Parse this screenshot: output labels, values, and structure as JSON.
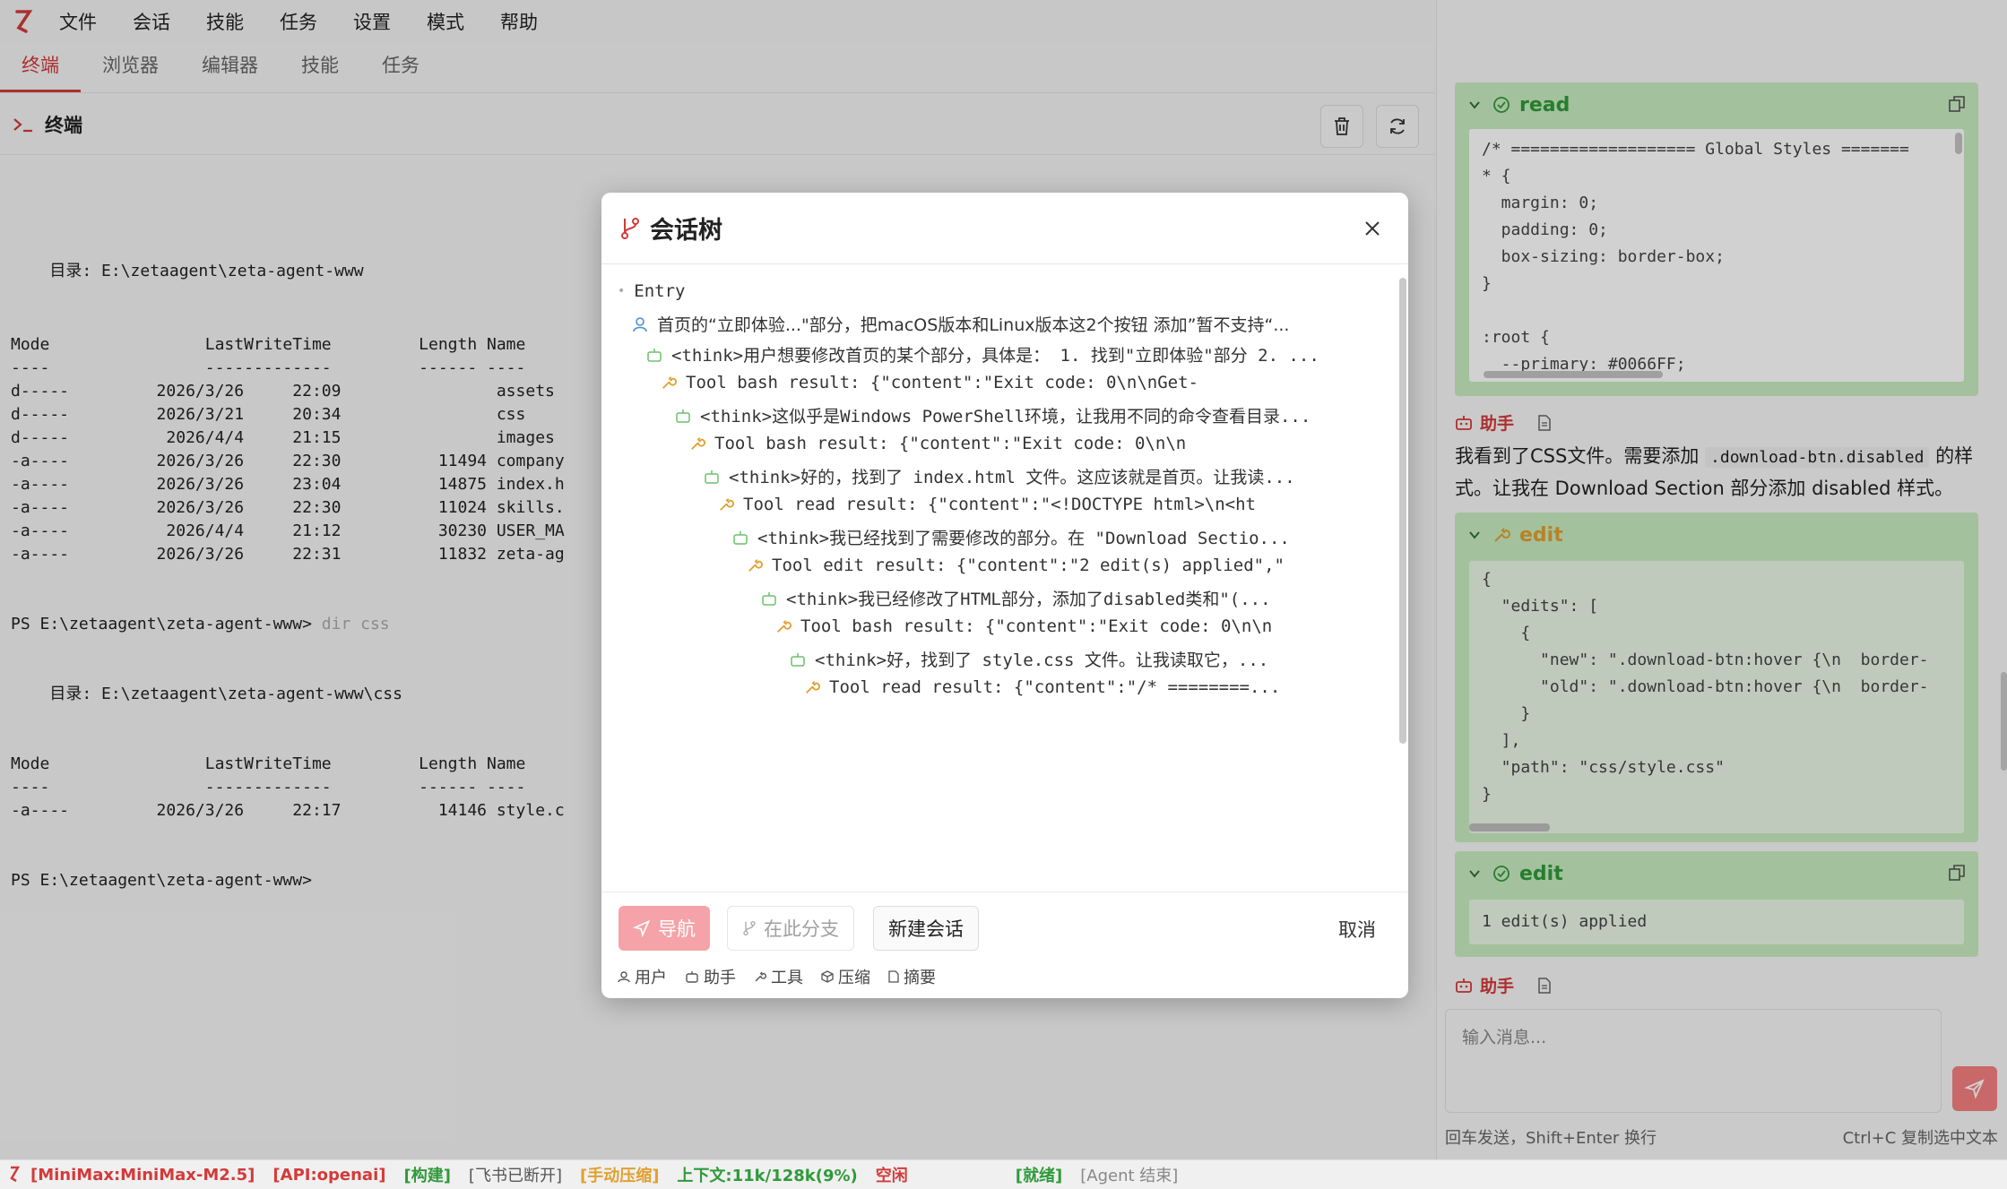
{
  "menubar": {
    "items": [
      "文件",
      "会话",
      "技能",
      "任务",
      "设置",
      "模式",
      "帮助"
    ],
    "profile": "default"
  },
  "tabs": [
    {
      "label": "终端",
      "active": true
    },
    {
      "label": "浏览器",
      "active": false
    },
    {
      "label": "编辑器",
      "active": false
    },
    {
      "label": "技能",
      "active": false
    },
    {
      "label": "任务",
      "active": false
    }
  ],
  "terminal": {
    "title": "终端",
    "lines": [
      "    目录: E:\\zetaagent\\zeta-agent-www",
      "Mode                LastWriteTime         Length Name",
      "----                -------------         ------ ----",
      "d-----         2026/3/26     22:09                assets",
      "d-----         2026/3/21     20:34                css",
      "d-----          2026/4/4     21:15                images",
      "-a----         2026/3/26     22:30          11494 company",
      "-a----         2026/3/26     23:04          14875 index.h",
      "-a----         2026/3/26     22:30          11024 skills.",
      "-a----          2026/4/4     21:12          30230 USER_MA",
      "-a----         2026/3/26     22:31          11832 zeta-ag",
      "PS E:\\zetaagent\\zeta-agent-www> ",
      "    目录: E:\\zetaagent\\zeta-agent-www\\css",
      "Mode                LastWriteTime         Length Name",
      "----                -------------         ------ ----",
      "-a----         2026/3/26     22:17          14146 style.c",
      "PS E:\\zetaagent\\zeta-agent-www>"
    ],
    "cmd_typed": "dir css"
  },
  "chat": {
    "read_card": {
      "name": "read",
      "lines": [
        "/* =================== Global Styles =======",
        "* {",
        "  margin: 0;",
        "  padding: 0;",
        "  box-sizing: border-box;",
        "}",
        "",
        ":root {",
        "  --primary: #0066FF;"
      ]
    },
    "assistant_label": "助手",
    "assistant_text_1": "我看到了CSS文件。需要添加",
    "assistant_code": ".download-btn.disabled",
    "assistant_text_2": "的样式。让我在 Download Section 部分添加 disabled 样式。",
    "edit_card_1": {
      "name": "edit",
      "lines": [
        "{",
        "  \"edits\": [",
        "    {",
        "      \"new\": \".download-btn:hover {\\n  border-",
        "      \"old\": \".download-btn:hover {\\n  border-",
        "    }",
        "  ],",
        "  \"path\": \"css/style.css\"",
        "}"
      ]
    },
    "edit_card_2": {
      "name": "edit",
      "result": "1 edit(s) applied"
    },
    "assistant_label_2": "助手",
    "input_placeholder": "输入消息...",
    "hint_left": "回车发送，Shift+Enter 换行",
    "hint_right": "Ctrl+C 复制选中文本"
  },
  "modal": {
    "title": "会话树",
    "entry": "Entry",
    "nodes": [
      {
        "kind": "user",
        "text": "首页的“立即体验...\"部分，把macOS版本和Linux版本这2个按钮 添加”暂不支持“..."
      },
      {
        "kind": "assistant",
        "text": "<think>用户想要修改首页的某个部分，具体是： 1. 找到\"立即体验\"部分 2. ..."
      },
      {
        "kind": "tool",
        "text": "Tool bash result: {\"content\":\"Exit code: 0\\n\\nGet-"
      },
      {
        "kind": "assistant",
        "text": "<think>这似乎是Windows PowerShell环境，让我用不同的命令查看目录..."
      },
      {
        "kind": "tool",
        "text": "Tool bash result: {\"content\":\"Exit code: 0\\n\\n"
      },
      {
        "kind": "assistant",
        "text": "<think>好的，找到了 index.html 文件。这应该就是首页。让我读..."
      },
      {
        "kind": "tool",
        "text": "Tool read result: {\"content\":\"<!DOCTYPE html>\\n<ht"
      },
      {
        "kind": "assistant",
        "text": "<think>我已经找到了需要修改的部分。在 \"Download Sectio..."
      },
      {
        "kind": "tool",
        "text": "Tool edit result: {\"content\":\"2 edit(s) applied\",\""
      },
      {
        "kind": "assistant",
        "text": "<think>我已经修改了HTML部分，添加了disabled类和\"(..."
      },
      {
        "kind": "tool",
        "text": "Tool bash result: {\"content\":\"Exit code: 0\\n\\n"
      },
      {
        "kind": "assistant",
        "text": "<think>好，找到了 style.css 文件。让我读取它，..."
      },
      {
        "kind": "tool",
        "text": "Tool read result: {\"content\":\"/* ========..."
      }
    ],
    "buttons": {
      "nav": "导航",
      "branch": "在此分支",
      "new": "新建会话",
      "cancel": "取消"
    },
    "legend": {
      "user": "用户",
      "assistant": "助手",
      "tool": "工具",
      "compress": "压缩",
      "summary": "摘要"
    }
  },
  "statusbar": {
    "model": "[MiniMax:MiniMax-M2.5]",
    "api": "[API:openai]",
    "build": "[构建]",
    "feishu": "[飞书已断开]",
    "compress": "[手动压缩]",
    "context": "上下文:11k/128k(9%)",
    "idle": "空闲",
    "ready": "[就绪]",
    "agent": "[Agent 结束]"
  },
  "colors": {
    "accent": "#d33a3a",
    "tool_green": "#2f9a3a",
    "tool_bg": "#c9ecc0",
    "user_blue": "#4a8fd6",
    "wrench": "#e0a030"
  }
}
